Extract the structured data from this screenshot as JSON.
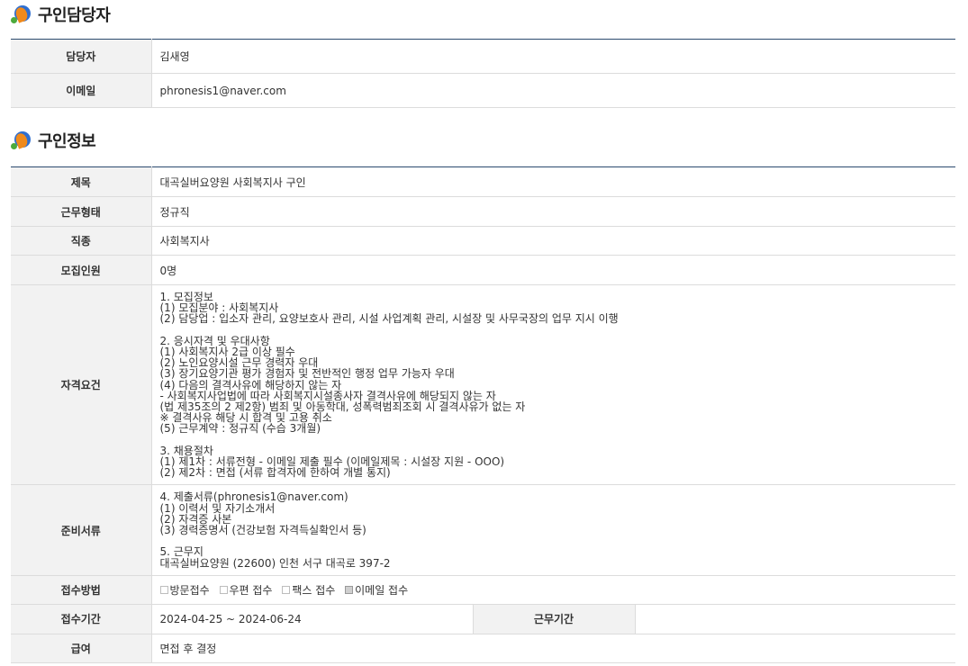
{
  "recruiter_section": {
    "title": "구인담당자",
    "rows": [
      {
        "label": "담당자",
        "value": "김새영"
      },
      {
        "label": "이메일",
        "value": "phronesis1@naver.com"
      }
    ]
  },
  "job_section": {
    "title": "구인정보",
    "rows": {
      "title": {
        "label": "제목",
        "value": "대곡실버요양원 사회복지사 구인"
      },
      "employment_type": {
        "label": "근무형태",
        "value": "정규직"
      },
      "occupation": {
        "label": "직종",
        "value": "사회복지사"
      },
      "headcount": {
        "label": "모집인원",
        "value": "0명"
      },
      "qualifications": {
        "label": "자격요건",
        "lines": [
          "1. 모집정보",
          "(1) 모집분야 : 사회복지사",
          "(2) 담당업 : 입소자 관리, 요양보호사 관리, 시설 사업계획 관리, 시설장 및 사무국장의 업무 지시 이행",
          "",
          "2. 응시자격 및 우대사항",
          "(1) 사회복지사 2급 이상 필수",
          "(2) 노인요양시설 근무 경력자 우대",
          "(3) 장기요양기관 평가 경험자 및 전반적인 행정 업무 가능자 우대",
          "(4) 다음의 결격사유에 해당하지 않는 자",
          "- 사회복지사업법에 따라 사회복지시설종사자 결격사유에 해당되지 않는 자",
          "(법 제35조의 2 제2항) 범죄 및 아동학대, 성폭력범죄조회 시 결격사유가 없는 자",
          "※ 결격사유 해당 시 합격 및 고용 취소",
          "(5) 근무계약 : 정규직 (수습 3개월)",
          "",
          "3. 채용절차",
          "(1) 제1차 : 서류전형 - 이메일 제출 필수 (이메일제목 : 시설장 지원 - OOO)",
          "(2) 제2차 : 면접 (서류 합격자에 한하여 개별 통지)"
        ]
      },
      "documents": {
        "label": "준비서류",
        "lines": [
          "4. 제출서류(phronesis1@naver.com)",
          "(1) 이력서 및 자기소개서",
          "(2) 자격증 사본",
          "(3) 경력증명서 (건강보험 자격득실확인서 등)",
          "",
          "5. 근무지",
          "대곡실버요양원 (22600) 인천 서구 대곡로 397-2"
        ]
      },
      "application_method": {
        "label": "접수방법",
        "options": [
          {
            "label": "방문접수",
            "checked": false
          },
          {
            "label": "우편 접수",
            "checked": false
          },
          {
            "label": "팩스 접수",
            "checked": false
          },
          {
            "label": "이메일 접수",
            "checked": true
          }
        ]
      },
      "period": {
        "label": "접수기간",
        "value": "2024-04-25 ~ 2024-06-24",
        "work_period_label": "근무기간",
        "work_period_value": ""
      },
      "salary": {
        "label": "급여",
        "value": "면접 후 결정"
      }
    }
  }
}
